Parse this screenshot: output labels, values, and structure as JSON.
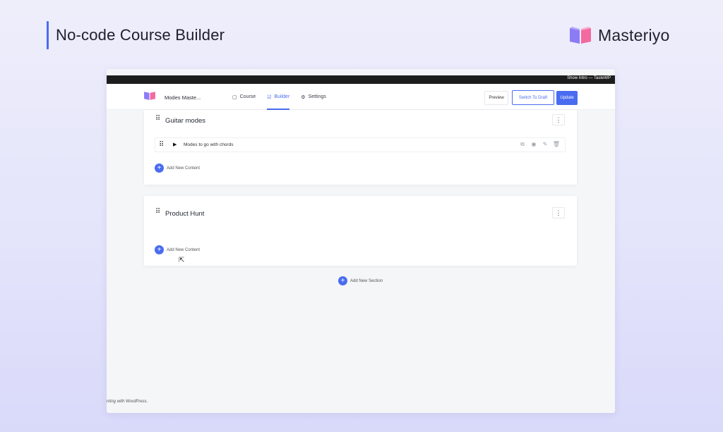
{
  "hero": {
    "title": "No-code Course Builder"
  },
  "brand": {
    "name": "Masteriyo",
    "icon": "open-book-logo-icon",
    "colors": {
      "left_page": "#8b7cf6",
      "right_page": "#f26aa0"
    }
  },
  "admin_bar": {
    "text": "Show Intro — TasteWP"
  },
  "app": {
    "course_name": "Modes Maste...",
    "nav": [
      {
        "label": "Course",
        "icon": "course-icon",
        "active": false
      },
      {
        "label": "Builder",
        "icon": "builder-icon",
        "active": true
      },
      {
        "label": "Settings",
        "icon": "settings-icon",
        "active": false
      }
    ],
    "buttons": {
      "preview": "Preview",
      "switch_draft": "Switch To Draft",
      "update": "Update"
    },
    "accent": "#4a6cf0"
  },
  "sections": [
    {
      "title": "Guitar modes",
      "lessons": [
        {
          "title": "Modes to go with chords",
          "icon": "play-icon"
        }
      ],
      "add_content": "Add New Content"
    },
    {
      "title": "Product Hunt",
      "lessons": [],
      "add_content": "Add New Content"
    }
  ],
  "add_section": "Add New Section",
  "footer": "nting with WordPress."
}
